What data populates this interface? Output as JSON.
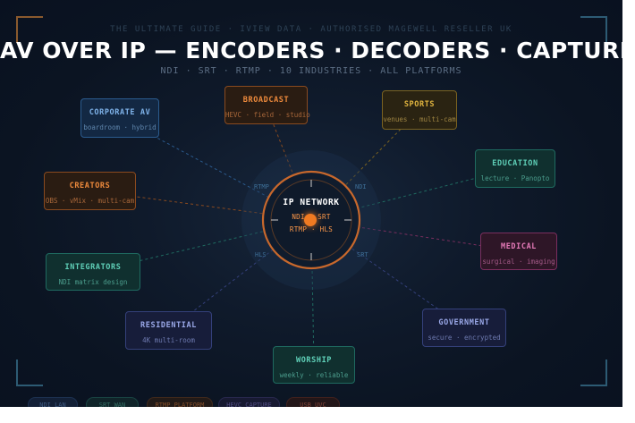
{
  "header": {
    "topline": "THE ULTIMATE GUIDE · IVIEW DATA · AUTHORISED MAGEWELL RESELLER UK",
    "title": "AV OVER IP — ENCODERS · DECODERS · CAPTURE CARDS",
    "subtitle": "NDI · SRT · RTMP · 10 INDUSTRIES · ALL PLATFORMS"
  },
  "hub": {
    "title": "IP NETWORK",
    "line1": "NDI · SRT",
    "line2": "RTMP · HLS",
    "protocol_labels": [
      "RTMP",
      "NDI",
      "HLS",
      "SRT"
    ]
  },
  "industries": [
    {
      "key": "corporate",
      "label": "CORPORATE AV",
      "sub": "boardroom · hybrid",
      "color": "blue"
    },
    {
      "key": "broadcast",
      "label": "BROADCAST",
      "sub": "HEVC · field · studio",
      "color": "orange"
    },
    {
      "key": "sports",
      "label": "SPORTS",
      "sub": "venues · multi-cam",
      "color": "gold"
    },
    {
      "key": "creators",
      "label": "CREATORS",
      "sub": "OBS · vMix · multi-cam",
      "color": "orange"
    },
    {
      "key": "education",
      "label": "EDUCATION",
      "sub": "lecture · Panopto",
      "color": "teal"
    },
    {
      "key": "medical",
      "label": "MEDICAL",
      "sub": "surgical · imaging",
      "color": "pink"
    },
    {
      "key": "integrators",
      "label": "INTEGRATORS",
      "sub": "NDI matrix design",
      "color": "teal"
    },
    {
      "key": "government",
      "label": "GOVERNMENT",
      "sub": "secure · encrypted",
      "color": "indigo"
    },
    {
      "key": "residential",
      "label": "RESIDENTIAL",
      "sub": "4K multi-room",
      "color": "indigo"
    },
    {
      "key": "worship",
      "label": "WORSHIP",
      "sub": "weekly · reliable",
      "color": "teal"
    }
  ],
  "footer_pills": [
    {
      "label": "NDI LAN",
      "color": "#5a8fd0"
    },
    {
      "label": "SRT WAN",
      "color": "#4fb89a"
    },
    {
      "label": "RTMP PLATFORM",
      "color": "#e07a30"
    },
    {
      "label": "HEVC CAPTURE",
      "color": "#8a78d0"
    },
    {
      "label": "USB UVC",
      "color": "#e06a4a"
    }
  ],
  "colors": {
    "background": "#0d1726",
    "hub_ring": "#c8682c",
    "accent": "#f07a22"
  }
}
